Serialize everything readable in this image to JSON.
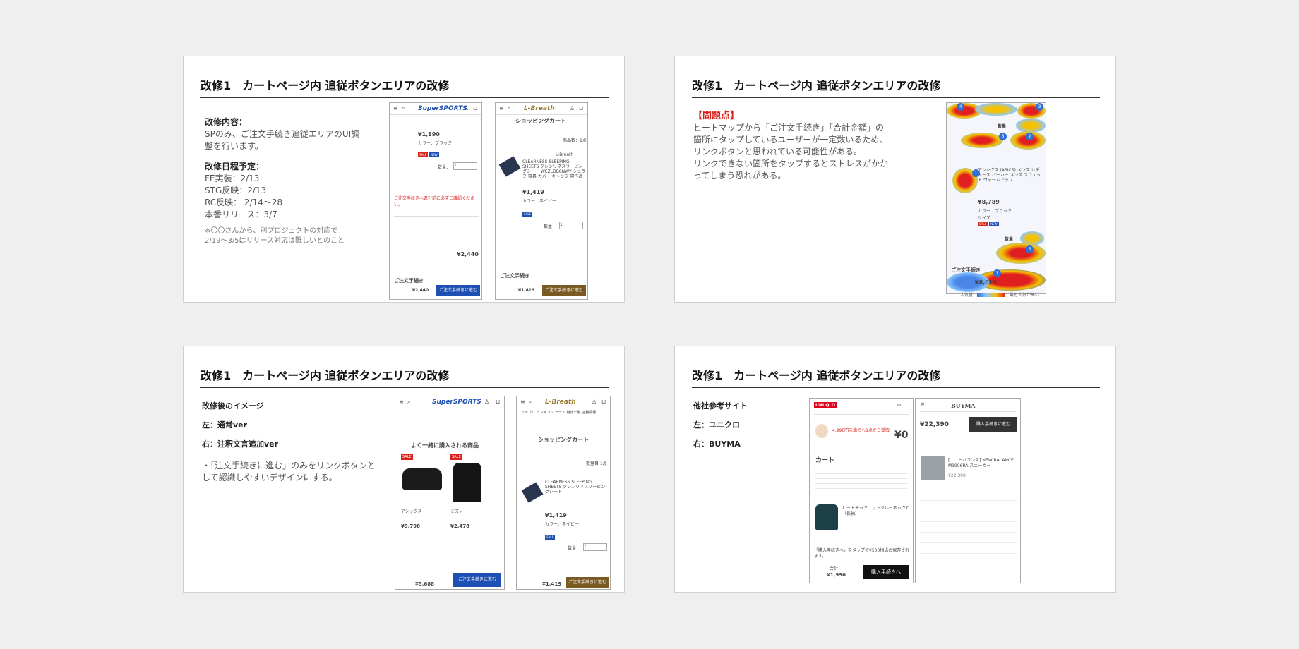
{
  "slides": {
    "s1": {
      "title": "改修1　カートページ内 追従ボタンエリアの改修",
      "content_heading": "改修内容：",
      "content_body": "SPのみ、ご注文手続き追従エリアのUI調整を行います。",
      "schedule_heading": "改修日程予定：",
      "schedule": [
        "FE実装：2/13",
        "STG反映：2/13",
        "RC反映： 2/14〜28",
        "本番リリース：3/7"
      ],
      "note": "※〇〇さんから、別プロジェクトの対応で2/19〜3/5はリリース対応は難しいとのこと",
      "phone_left": {
        "logo": "SuperSPORTS",
        "price": "¥1,890",
        "color": "カラー：ブラック",
        "qty_label": "数量：",
        "qty": "1",
        "warning": "ご注文手続きへ進む前に必ずご確認ください。",
        "total": "¥2,440",
        "checkout_label": "ご注文手続き",
        "button": "ご注文手続きに進む",
        "footer_price": "¥2,440"
      },
      "phone_right": {
        "logo": "L-Breath",
        "heading": "ショッピングカート",
        "count": "商品数：1点",
        "brand": "L-Breath",
        "item_name": "CLEARNESS SLEEPING SHEETS クレンリネスリーピングシート WEZLDB8NWY シュラフ 寝具 カバー キャンプ 寝作品",
        "price": "¥1,419",
        "color": "カラー：ネイビー",
        "qty_label": "数量：",
        "qty": "1",
        "checkout_label": "ご注文手続き",
        "button": "ご注文手続きに進む",
        "footer_price": "¥1,419"
      }
    },
    "s2": {
      "title": "改修1　カートページ内 追従ボタンエリアの改修",
      "problem_heading": "【問題点】",
      "problem_body": [
        "ヒートマップから「ご注文手続き」「合計金額」の",
        "箇所にタップしているユーザーが一定数いるため、",
        "リンクボタンと思われている可能性がある。",
        "リンクできない箇所をタップするとストレスがかか",
        "ってしまう恐れがある。"
      ],
      "heatmap": {
        "qty_label": "数量：",
        "item_name": "アシックス (ASICS) メンズ レディース パーカー メンズ スウェット ウォームアップ",
        "price": "¥8,789",
        "color": "カラー：ブラック",
        "size": "サイズ：L",
        "checkout_label": "ご注文手続き",
        "total": "¥8,010",
        "legend_left": "人気低",
        "legend_right": "最も人気が高い",
        "pins": [
          "4",
          "3",
          "5",
          "2",
          "1",
          "5",
          "1"
        ]
      }
    },
    "s3": {
      "title": "改修1　カートページ内 追従ボタンエリアの改修",
      "heading": "改修後のイメージ",
      "left_label": "左：通常ver",
      "right_label": "右：注釈文言追加ver",
      "bullet": [
        "・「注文手続きに進む」のみをリンクボタンと",
        "して認識しやすいデザインにする。"
      ],
      "phone_left": {
        "logo": "SuperSPORTS",
        "section": "よく一緒に購入される商品",
        "items": [
          {
            "brand": "アシックス",
            "price": "¥9,798",
            "sale": "SALE"
          },
          {
            "brand": "ミズノ",
            "price": "¥2,478",
            "sale": "SALE"
          }
        ],
        "button": "ご注文手続きに進む",
        "footer_price": "¥5,688"
      },
      "phone_right": {
        "logo": "L-Breath",
        "nav": "カテゴリ ランキング セール 特集一覧 店舗情報",
        "heading": "ショッピングカート",
        "count": "数量目 1点",
        "item_name": "CLEARNESS SLEEPING SHEETS クレンリネスリーピングシート",
        "price": "¥1,419",
        "color": "カラー：ネイビー",
        "qty_label": "数量：",
        "qty": "1",
        "button": "ご注文手続きに進む",
        "footer_price": "¥1,419"
      }
    },
    "s4": {
      "title": "改修1　カートページ内 追従ボタンエリアの改修",
      "heading": "他社参考サイト",
      "left_label": "左：ユニクロ",
      "right_label": "右：BUYMA",
      "uniqlo": {
        "logo": "UNI QLO",
        "promo": "4,990円未満でも1点から受取",
        "promo_price": "¥0",
        "cart_title": "カート",
        "item_name": "ヒートテックニットクルーネックT（長袖）",
        "note": "「購入手続きへ」をタップで¥500相当の保存されます。",
        "total_label": "合計",
        "total": "¥1,990",
        "button": "購入手続きへ"
      },
      "buyma": {
        "logo": "BUYMA",
        "price": "¥22,390",
        "button": "購入手続きに進む",
        "item_name": "[ニューバランス] NEW BALANCE M1906RA スニーカー",
        "item_price": "¥22,390"
      }
    }
  }
}
